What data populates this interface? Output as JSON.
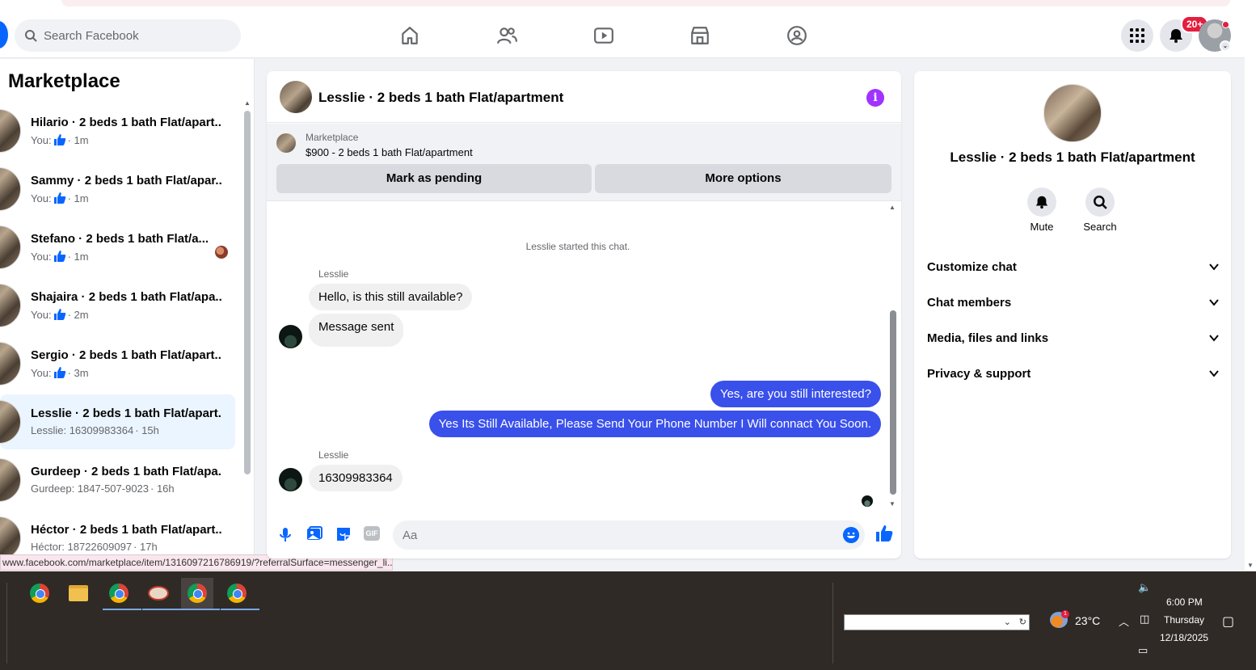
{
  "search": {
    "placeholder": "Search Facebook"
  },
  "notifications": {
    "badge": "20+"
  },
  "marketplace": {
    "title": "Marketplace",
    "conversations": [
      {
        "name": "Hilario · 2 beds 1 bath Flat/apart...",
        "prefix": "You:",
        "liked": true,
        "time": "· 1m",
        "active": false
      },
      {
        "name": "Sammy · 2 beds 1 bath Flat/apar...",
        "prefix": "You:",
        "liked": true,
        "time": "· 1m",
        "active": false
      },
      {
        "name": "Stefano · 2 beds 1 bath Flat/a...",
        "prefix": "You:",
        "liked": true,
        "time": "· 1m",
        "active": false
      },
      {
        "name": "Shajaira · 2 beds 1 bath Flat/apa...",
        "prefix": "You:",
        "liked": true,
        "time": "· 2m",
        "active": false
      },
      {
        "name": "Sergio · 2 beds 1 bath Flat/apart...",
        "prefix": "You:",
        "liked": true,
        "time": "· 3m",
        "active": false
      },
      {
        "name": "Lesslie · 2 beds 1 bath Flat/apart...",
        "prefix": "Lesslie: 16309983364",
        "liked": false,
        "time": "· 15h",
        "active": true
      },
      {
        "name": "Gurdeep · 2 beds 1 bath Flat/apa...",
        "prefix": "Gurdeep: 1847-507-9023",
        "liked": false,
        "time": "· 16h",
        "active": false
      },
      {
        "name": "Héctor · 2 beds 1 bath Flat/apart...",
        "prefix": "Héctor: 18722609097",
        "liked": false,
        "time": "· 17h",
        "active": false
      }
    ]
  },
  "status_url": "www.facebook.com/marketplace/item/1316097216786919/?referralSurface=messenger_li...",
  "chat": {
    "title": "Lesslie · 2 beds 1 bath Flat/apartment",
    "listing": {
      "source": "Marketplace",
      "price_line": "$900 - 2 beds 1 bath Flat/apartment",
      "mark_pending": "Mark as pending",
      "more_options": "More options"
    },
    "started_text": "Lesslie started this chat.",
    "messages": {
      "sender1": "Lesslie",
      "in1": "Hello, is this still available?",
      "in2": "Message sent",
      "out1": "Yes, are you still interested?",
      "out2": "Yes Its Still Available, Please Send Your Phone Number I Will connact You Soon.",
      "sender2": "Lesslie",
      "in3": "16309983364"
    },
    "composer": {
      "placeholder": "Aa",
      "gif": "GIF"
    }
  },
  "details": {
    "title": "Lesslie · 2 beds 1 bath Flat/apartment",
    "mute": "Mute",
    "search": "Search",
    "sections": [
      "Customize chat",
      "Chat members",
      "Media, files and links",
      "Privacy & support"
    ]
  },
  "taskbar": {
    "temperature": "23°C",
    "weather_badge": "1",
    "time": "6:00 PM",
    "day": "Thursday",
    "date": "12/18/2025"
  }
}
